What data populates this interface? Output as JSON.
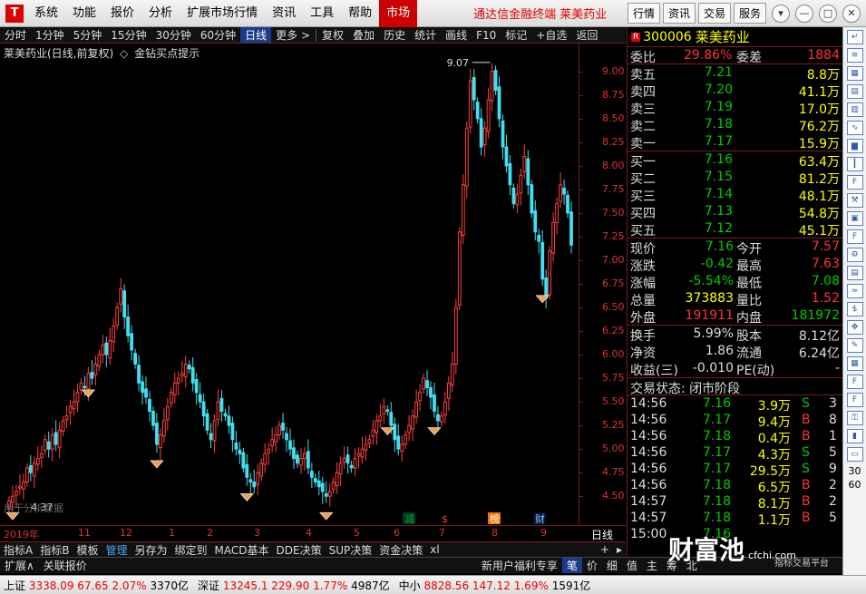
{
  "menubar": {
    "logo": "T",
    "items": [
      "系统",
      "功能",
      "报价",
      "分析",
      "扩展市场行情",
      "资讯",
      "工具",
      "帮助"
    ],
    "active": "市场",
    "app_title": "通达信金融终端  莱美药业",
    "right_buttons": [
      "行情",
      "资讯",
      "交易",
      "服务"
    ],
    "window_controls": [
      "▾",
      "—",
      "□",
      "✕"
    ]
  },
  "toolbar": {
    "periods": [
      "分时",
      "1分钟",
      "5分钟",
      "15分钟",
      "30分钟",
      "60分钟",
      "日线",
      "更多 >"
    ],
    "selected": "日线",
    "tools": [
      "复权",
      "叠加",
      "历史",
      "统计",
      "画线",
      "F10",
      "标记",
      "+自选",
      "返回"
    ]
  },
  "chart": {
    "header": "莱美药业(日线,前复权)",
    "indicator_label": "金钻买点提示",
    "peak_label": "9.07",
    "low_label": "4.37",
    "watermark": "用于分析数据",
    "period_label": "日线",
    "y_ticks": [
      "9.00",
      "8.75",
      "8.50",
      "8.25",
      "8.00",
      "7.75",
      "7.50",
      "7.25",
      "7.00",
      "6.75",
      "6.50",
      "6.25",
      "6.00",
      "5.75",
      "5.50",
      "5.25",
      "5.00",
      "4.75",
      "4.50"
    ],
    "x_ticks": [
      "2019年",
      "11",
      "12",
      "1",
      "2",
      "3",
      "4",
      "5",
      "6",
      "7",
      "8",
      "9"
    ],
    "event_badges": [
      {
        "text": "减",
        "color": "#0a0",
        "bg": "#033"
      },
      {
        "text": "$",
        "color": "#f33",
        "bg": "#000"
      },
      {
        "text": "榜",
        "color": "#fff",
        "bg": "#e70"
      },
      {
        "text": "财",
        "color": "#8cf",
        "bg": "#013"
      }
    ]
  },
  "chart_data": {
    "type": "candlestick",
    "title": "莱美药业(日线,前复权)",
    "ylim": [
      4.3,
      9.2
    ],
    "x_ticks": [
      "2019年",
      "11",
      "12",
      "1",
      "2",
      "3",
      "4",
      "5",
      "6",
      "7",
      "8",
      "9"
    ],
    "close_series_approx": [
      4.45,
      4.5,
      4.55,
      4.6,
      4.65,
      4.8,
      4.75,
      4.85,
      4.9,
      4.95,
      5.1,
      5.0,
      5.15,
      5.05,
      5.2,
      5.3,
      5.35,
      5.45,
      5.5,
      5.6,
      5.7,
      5.65,
      5.8,
      5.75,
      5.9,
      6.0,
      6.1,
      6.0,
      6.15,
      6.3,
      6.5,
      6.7,
      6.4,
      6.2,
      6.05,
      5.9,
      5.7,
      5.6,
      5.55,
      5.4,
      5.25,
      5.05,
      5.15,
      5.3,
      5.45,
      5.6,
      5.7,
      5.75,
      5.8,
      5.9,
      5.85,
      5.7,
      5.6,
      5.5,
      5.35,
      5.2,
      5.1,
      5.3,
      5.5,
      5.4,
      5.35,
      5.25,
      5.1,
      5.0,
      4.95,
      4.8,
      4.7,
      4.65,
      4.6,
      4.75,
      4.85,
      4.95,
      5.0,
      5.1,
      5.15,
      5.25,
      5.2,
      5.1,
      5.0,
      4.9,
      4.85,
      4.9,
      4.95,
      4.8,
      4.7,
      4.65,
      4.6,
      4.55,
      4.5,
      4.55,
      4.65,
      4.75,
      4.85,
      4.9,
      4.85,
      4.8,
      4.9,
      4.95,
      5.0,
      5.05,
      5.1,
      5.2,
      5.3,
      5.35,
      5.45,
      5.4,
      5.25,
      5.1,
      5.0,
      5.05,
      5.15,
      5.25,
      5.35,
      5.5,
      5.6,
      5.75,
      5.65,
      5.55,
      5.4,
      5.3,
      5.35,
      5.5,
      5.7,
      5.9,
      6.5,
      7.3,
      7.8,
      8.4,
      8.9,
      8.7,
      8.5,
      8.2,
      8.4,
      8.7,
      9.0,
      8.8,
      8.5,
      8.2,
      8.0,
      7.8,
      7.6,
      7.7,
      7.9,
      8.1,
      7.8,
      7.5,
      7.3,
      7.2,
      6.8,
      6.6,
      7.1,
      7.4,
      7.6,
      7.8,
      7.7,
      7.5,
      7.16
    ]
  },
  "indicator_tabs": [
    "指标A",
    "指标B",
    "模板",
    "管理",
    "另存为",
    "绑定到",
    "MACD基本",
    "DDE决策",
    "SUP决策",
    "资金决策",
    "xl"
  ],
  "bottom_tabs": [
    "扩展∧",
    "关联报价",
    "新用户福利专享",
    "笔",
    "价",
    "细",
    "值",
    "主",
    "筹",
    "北"
  ],
  "quote": {
    "badge": "R",
    "code": "300006",
    "name": "莱美药业",
    "wb_label": "委比",
    "wb_value": "29.86%",
    "wc_label": "委差",
    "wc_value": "1884",
    "asks": [
      {
        "label": "卖五",
        "price": "7.21",
        "vol": "8.8万"
      },
      {
        "label": "卖四",
        "price": "7.20",
        "vol": "41.1万"
      },
      {
        "label": "卖三",
        "price": "7.19",
        "vol": "17.0万"
      },
      {
        "label": "卖二",
        "price": "7.18",
        "vol": "76.2万"
      },
      {
        "label": "卖一",
        "price": "7.17",
        "vol": "15.9万"
      }
    ],
    "bids": [
      {
        "label": "买一",
        "price": "7.16",
        "vol": "63.4万"
      },
      {
        "label": "买二",
        "price": "7.15",
        "vol": "81.2万"
      },
      {
        "label": "买三",
        "price": "7.14",
        "vol": "48.1万"
      },
      {
        "label": "买四",
        "price": "7.13",
        "vol": "54.8万"
      },
      {
        "label": "买五",
        "price": "7.12",
        "vol": "45.1万"
      }
    ],
    "stats": [
      {
        "l1": "现价",
        "v1": "7.16",
        "c1": "g",
        "l2": "今开",
        "v2": "7.57",
        "c2": "r"
      },
      {
        "l1": "涨跌",
        "v1": "-0.42",
        "c1": "g",
        "l2": "最高",
        "v2": "7.63",
        "c2": "r"
      },
      {
        "l1": "涨幅",
        "v1": "-5.54%",
        "c1": "g",
        "l2": "最低",
        "v2": "7.08",
        "c2": "g"
      },
      {
        "l1": "总量",
        "v1": "373883",
        "c1": "y",
        "l2": "量比",
        "v2": "1.52",
        "c2": "r"
      },
      {
        "l1": "外盘",
        "v1": "191911",
        "c1": "r",
        "l2": "内盘",
        "v2": "181972",
        "c2": "g"
      }
    ],
    "stats2": [
      {
        "l1": "换手",
        "v1": "5.99%",
        "l2": "股本",
        "v2": "8.12亿"
      },
      {
        "l1": "净资",
        "v1": "1.86",
        "l2": "流通",
        "v2": "6.24亿"
      },
      {
        "l1": "收益(三)",
        "v1": "-0.010",
        "l2": "PE(动)",
        "v2": "-"
      }
    ],
    "trade_status": "交易状态: 闭市阶段",
    "trades": [
      {
        "time": "14:56",
        "price": "7.16",
        "pc": "g",
        "vol": "3.9万",
        "bs": "S",
        "n": "3"
      },
      {
        "time": "14:56",
        "price": "7.17",
        "pc": "g",
        "vol": "9.4万",
        "bs": "B",
        "n": "8"
      },
      {
        "time": "14:56",
        "price": "7.18",
        "pc": "g",
        "vol": "0.4万",
        "bs": "B",
        "n": "1"
      },
      {
        "time": "14:56",
        "price": "7.17",
        "pc": "g",
        "vol": "4.3万",
        "bs": "S",
        "n": "5"
      },
      {
        "time": "14:56",
        "price": "7.17",
        "pc": "g",
        "vol": "29.5万",
        "bs": "S",
        "n": "9"
      },
      {
        "time": "14:56",
        "price": "7.18",
        "pc": "g",
        "vol": "6.5万",
        "bs": "B",
        "n": "2"
      },
      {
        "time": "14:57",
        "price": "7.18",
        "pc": "g",
        "vol": "8.1万",
        "bs": "B",
        "n": "2"
      },
      {
        "time": "14:57",
        "price": "7.18",
        "pc": "g",
        "vol": "1.1万",
        "bs": "B",
        "n": "5"
      },
      {
        "time": "15:00",
        "price": "7.16",
        "pc": "g",
        "vol": "",
        "bs": "",
        "n": ""
      }
    ]
  },
  "status": {
    "sh_label": "上证",
    "sh_value": "3338.09",
    "sh_change": "67.65",
    "sh_pct": "2.07%",
    "sh_amount": "3370亿",
    "sz_label": "深证",
    "sz_value": "13245.1",
    "sz_change": "229.90",
    "sz_pct": "1.77%",
    "sz_amount": "4987亿",
    "zx_label": "中小",
    "zx_value": "8828.56",
    "zx_change": "147.12",
    "zx_pct": "1.69%",
    "zx_amount": "1591亿"
  },
  "watermark_brand": "财富池",
  "watermark_url": "cfchi.com",
  "watermark_sub": "指标交易平台",
  "sidebar_icons": [
    "arrow-icon",
    "list-icon",
    "grid-icon",
    "grid2-icon",
    "table-icon",
    "trend-icon",
    "chart-icon",
    "candle-icon",
    "f10-icon",
    "tool-icon",
    "cal-icon",
    "f12-icon",
    "cog-icon",
    "book-icon",
    "rsi-icon",
    "dollar-icon",
    "move-icon",
    "pen-icon",
    "table2-icon",
    "f5-icon",
    "f6-icon",
    "key-icon",
    "vol-icon",
    "box-icon"
  ],
  "sidebar_bottom": [
    "30",
    "60"
  ]
}
